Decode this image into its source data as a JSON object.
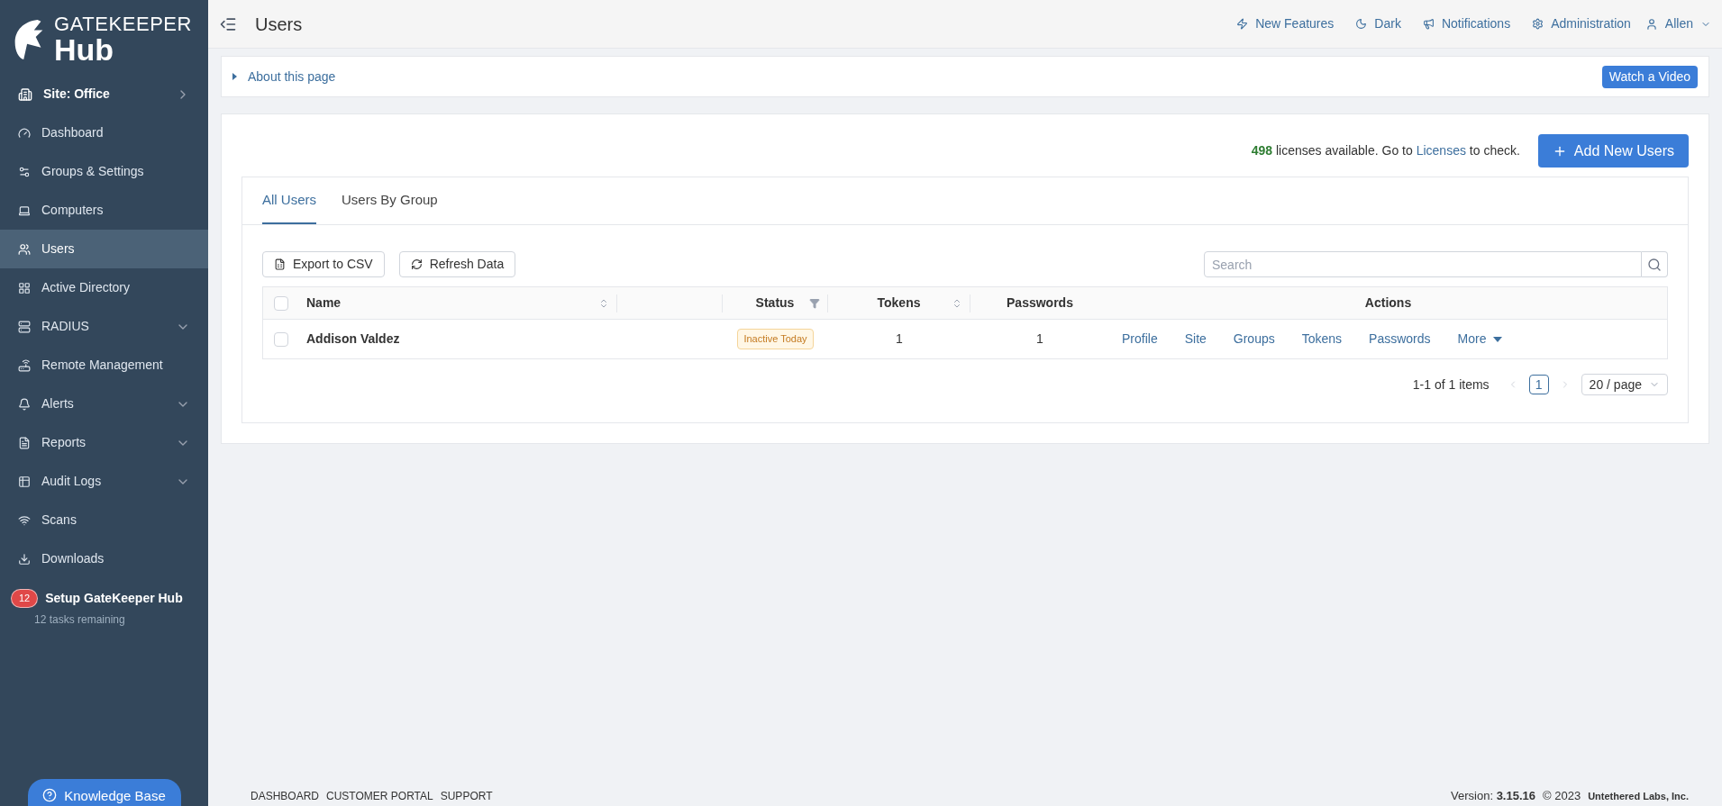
{
  "sidebar": {
    "logo": {
      "top": "GATEKEEPER",
      "bottom": "Hub"
    },
    "site": "Site: Office",
    "items": [
      {
        "label": "Dashboard",
        "selected": false,
        "expandable": false
      },
      {
        "label": "Groups & Settings",
        "selected": false,
        "expandable": false
      },
      {
        "label": "Computers",
        "selected": false,
        "expandable": false
      },
      {
        "label": "Users",
        "selected": true,
        "expandable": false
      },
      {
        "label": "Active Directory",
        "selected": false,
        "expandable": false
      },
      {
        "label": "RADIUS",
        "selected": false,
        "expandable": true
      },
      {
        "label": "Remote Management",
        "selected": false,
        "expandable": false
      },
      {
        "label": "Alerts",
        "selected": false,
        "expandable": true
      },
      {
        "label": "Reports",
        "selected": false,
        "expandable": true
      },
      {
        "label": "Audit Logs",
        "selected": false,
        "expandable": true
      },
      {
        "label": "Scans",
        "selected": false,
        "expandable": false
      },
      {
        "label": "Downloads",
        "selected": false,
        "expandable": false
      }
    ],
    "setup": {
      "badge": "12",
      "title": "Setup GateKeeper Hub",
      "subtitle": "12 tasks remaining"
    },
    "knowledge_base": "Knowledge Base"
  },
  "header": {
    "title": "Users",
    "links": [
      "New Features",
      "Dark",
      "Notifications",
      "Administration"
    ],
    "user": "Allen"
  },
  "about": {
    "label": "About this page",
    "video_button": "Watch a Video"
  },
  "licenses": {
    "count": "498",
    "text": "licenses available. Go to",
    "link": "Licenses",
    "suffix": "to check."
  },
  "add_button": "Add New Users",
  "tabs": [
    {
      "label": "All Users",
      "selected": true
    },
    {
      "label": "Users By Group",
      "selected": false
    }
  ],
  "toolbar": {
    "buttons": [
      "Export to CSV",
      "Refresh Data"
    ],
    "search": {
      "placeholder": "Search"
    }
  },
  "table": {
    "select_all": {
      "checked": false
    },
    "columns": [
      {
        "label": "Name",
        "sortable": true
      },
      {
        "label": "Status",
        "filterable": true
      },
      {
        "label": "Tokens",
        "sortable": true
      },
      {
        "label": "Passwords"
      },
      {
        "label": "Actions"
      }
    ],
    "rows": [
      {
        "name": "Addison Valdez",
        "checked": false,
        "status": "Inactive Today",
        "tokens": "1",
        "passwords": "1",
        "actions": [
          "Profile",
          "Site",
          "Groups",
          "Tokens",
          "Passwords"
        ],
        "more": "More"
      }
    ]
  },
  "pagination": {
    "summary": "1-1 of 1 items",
    "pages": [
      {
        "label": "1",
        "selected": true
      }
    ],
    "page_size": "20 / page"
  },
  "footer": {
    "links": [
      "DASHBOARD",
      "CUSTOMER PORTAL",
      "SUPPORT"
    ],
    "version_label": "Version:",
    "version": "3.15.16",
    "copyright": "© 2023",
    "company": "Untethered Labs, Inc."
  }
}
